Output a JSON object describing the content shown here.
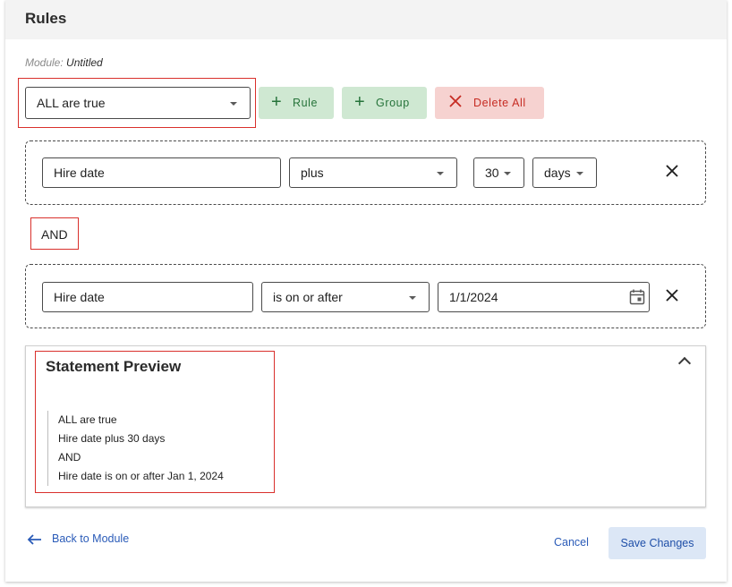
{
  "header": {
    "title": "Rules"
  },
  "module": {
    "label": "Module:",
    "name": "Untitled"
  },
  "toolbar": {
    "condition_select": "ALL are true",
    "add_rule_label": "Rule",
    "add_group_label": "Group",
    "delete_all_label": "Delete All"
  },
  "rules": [
    {
      "field": "Hire date",
      "operator": "plus",
      "amount": "30",
      "unit": "days"
    },
    {
      "field": "Hire date",
      "operator": "is on or after",
      "date": "1/1/2024"
    }
  ],
  "connector": "AND",
  "preview": {
    "title": "Statement Preview",
    "lines": [
      "ALL are true",
      "Hire date plus 30 days",
      "AND",
      "Hire date is on or after Jan 1, 2024"
    ]
  },
  "footer": {
    "back_label": "Back to Module",
    "cancel_label": "Cancel",
    "save_label": "Save Changes"
  },
  "colors": {
    "accent": "#2a5bb8",
    "positive_bg": "#cfe8d2",
    "positive_fg": "#26733a",
    "danger_bg": "#f6d2d0",
    "danger_fg": "#c62b22",
    "highlight_border": "#d9302c"
  },
  "icons": {
    "add": "plus-icon",
    "delete": "x-icon",
    "remove_rule": "close-icon",
    "date": "calendar-icon",
    "collapse": "chevron-up-icon",
    "back": "arrow-left-icon"
  }
}
